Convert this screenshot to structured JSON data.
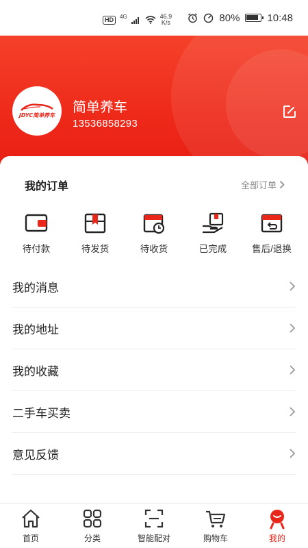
{
  "status_bar": {
    "network_badge": "HD",
    "signal_label": "4G",
    "speed_value": "46.9",
    "speed_unit": "K/s",
    "battery": "80%",
    "time": "10:48"
  },
  "profile": {
    "logo_text": "JDYC简单养车",
    "username": "简单养车",
    "phone": "13536858293"
  },
  "orders": {
    "title": "我的订单",
    "all_label": "全部订单",
    "items": [
      {
        "label": "待付款",
        "icon": "wallet-icon"
      },
      {
        "label": "待发货",
        "icon": "package-icon"
      },
      {
        "label": "待收货",
        "icon": "calendar-clock-icon"
      },
      {
        "label": "已完成",
        "icon": "hand-box-icon"
      },
      {
        "label": "售后/退换",
        "icon": "return-icon"
      }
    ]
  },
  "menu": [
    {
      "label": "我的消息"
    },
    {
      "label": "我的地址"
    },
    {
      "label": "我的收藏"
    },
    {
      "label": "二手车买卖"
    },
    {
      "label": "意见反馈"
    }
  ],
  "tabbar": [
    {
      "label": "首页",
      "icon": "home-icon"
    },
    {
      "label": "分类",
      "icon": "grid-icon"
    },
    {
      "label": "智能配对",
      "icon": "scan-icon"
    },
    {
      "label": "购物车",
      "icon": "cart-icon"
    },
    {
      "label": "我的",
      "icon": "profile-icon"
    }
  ],
  "colors": {
    "accent": "#e8261a",
    "header": "#f0301f"
  }
}
